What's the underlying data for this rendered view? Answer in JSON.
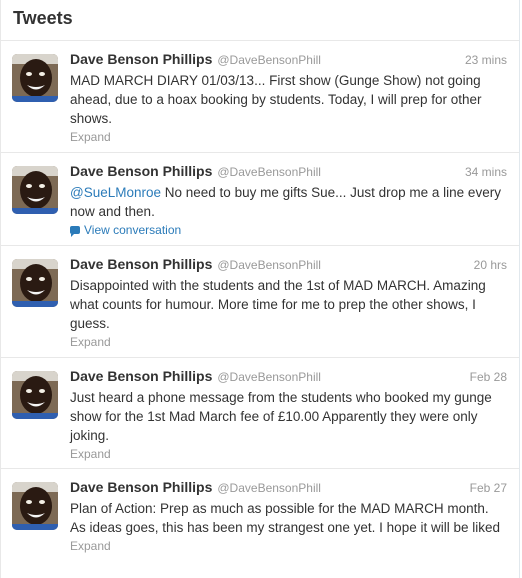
{
  "header": {
    "title": "Tweets"
  },
  "colors": {
    "link": "#2b7bb9",
    "meta": "#999999",
    "text": "#333333",
    "divider": "#e8e8e8"
  },
  "tweets": [
    {
      "name": "Dave Benson Phillips",
      "handle": "@DaveBensonPhill",
      "time": "23 mins",
      "mention": "",
      "text": "MAD MARCH DIARY 01/03/13... First show (Gunge Show) not going ahead, due to a hoax booking by students. Today, I will prep for other shows.",
      "action": "Expand",
      "action_icon": ""
    },
    {
      "name": "Dave Benson Phillips",
      "handle": "@DaveBensonPhill",
      "time": "34 mins",
      "mention": "@SueLMonroe",
      "text": " No need to buy me gifts Sue... Just drop me a line every now and then.",
      "action": "View conversation",
      "action_icon": "conversation-icon"
    },
    {
      "name": "Dave Benson Phillips",
      "handle": "@DaveBensonPhill",
      "time": "20 hrs",
      "mention": "",
      "text": "Disappointed with the students and the 1st of MAD MARCH. Amazing what counts for humour. More time for me to prep the other shows, I guess.",
      "action": "Expand",
      "action_icon": ""
    },
    {
      "name": "Dave Benson Phillips",
      "handle": "@DaveBensonPhill",
      "time": "Feb 28",
      "mention": "",
      "text": "Just heard a phone message from the students who booked my gunge show for the 1st Mad March fee of £10.00 Apparently they were only joking.",
      "action": "Expand",
      "action_icon": ""
    },
    {
      "name": "Dave Benson Phillips",
      "handle": "@DaveBensonPhill",
      "time": "Feb 27",
      "mention": "",
      "text": "Plan of Action: Prep as much as possible for the MAD MARCH month. As ideas goes, this has been my strangest one yet. I hope it will be liked",
      "action": "Expand",
      "action_icon": ""
    }
  ]
}
